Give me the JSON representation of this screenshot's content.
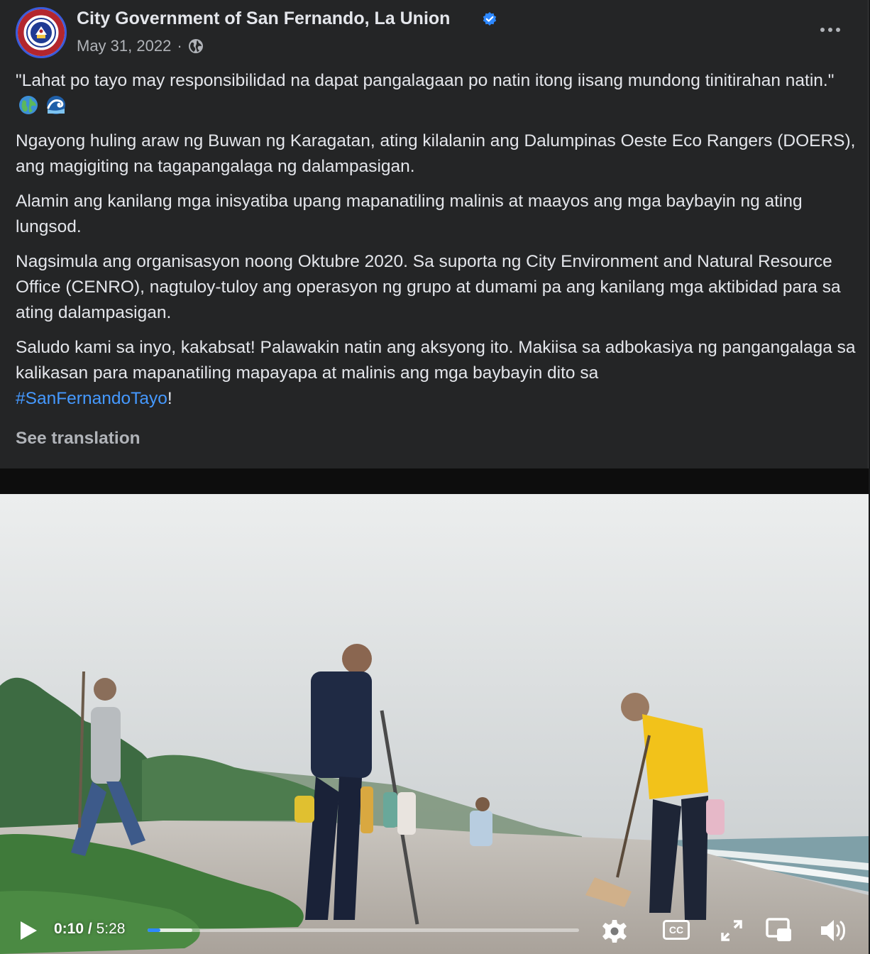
{
  "post": {
    "page_name": "City Government of San Fernando, La Union",
    "verified": true,
    "date": "May 31, 2022",
    "separator": "·",
    "audience_icon": "globe-icon",
    "paragraphs": [
      "\"Lahat po tayo may responsibilidad na dapat pangalagaan po natin itong iisang mundong tinitirahan natin.\"",
      "Ngayong huling araw ng Buwan ng Karagatan, ating kilalanin ang Dalumpinas Oeste Eco Rangers (DOERS), ang magigiting na tagapangalaga ng dalampasigan.",
      "Alamin ang kanilang mga inisyatiba upang mapanatiling malinis at maayos ang mga baybayin ng ating lungsod.",
      "Nagsimula ang organisasyon noong Oktubre 2020. Sa suporta ng City Environment and Natural Resource Office (CENRO), nagtuloy-tuloy ang operasyon ng grupo at dumami pa ang kanilang mga aktibidad para sa ating dalampasigan.",
      "Saludo kami sa inyo, kakabsat! Palawakin natin ang aksyong ito. Makiisa sa adbokasiya ng pangangalaga sa kalikasan para mapanatiling mapayapa at malinis ang mga baybayin dito sa"
    ],
    "hashtag": "#SanFernandoTayo",
    "hashtag_suffix": "!",
    "emojis": [
      "globe-emoji",
      "wave-emoji"
    ],
    "see_translation": "See translation"
  },
  "video": {
    "current_time": "0:10",
    "time_separator": "/",
    "duration": "5:28",
    "progress_fraction": 0.03,
    "buffered_fraction": 0.104,
    "controls": [
      "play-icon",
      "settings-icon",
      "captions-icon",
      "expand-icon",
      "picture-in-picture-icon",
      "volume-icon"
    ],
    "captions_label": "CC"
  },
  "colors": {
    "background": "#242526",
    "text": "#e4e6eb",
    "secondary_text": "#b0b3b8",
    "link": "#4599ff",
    "verified_badge": "#2d88ff",
    "progress": "#2d88ff"
  }
}
